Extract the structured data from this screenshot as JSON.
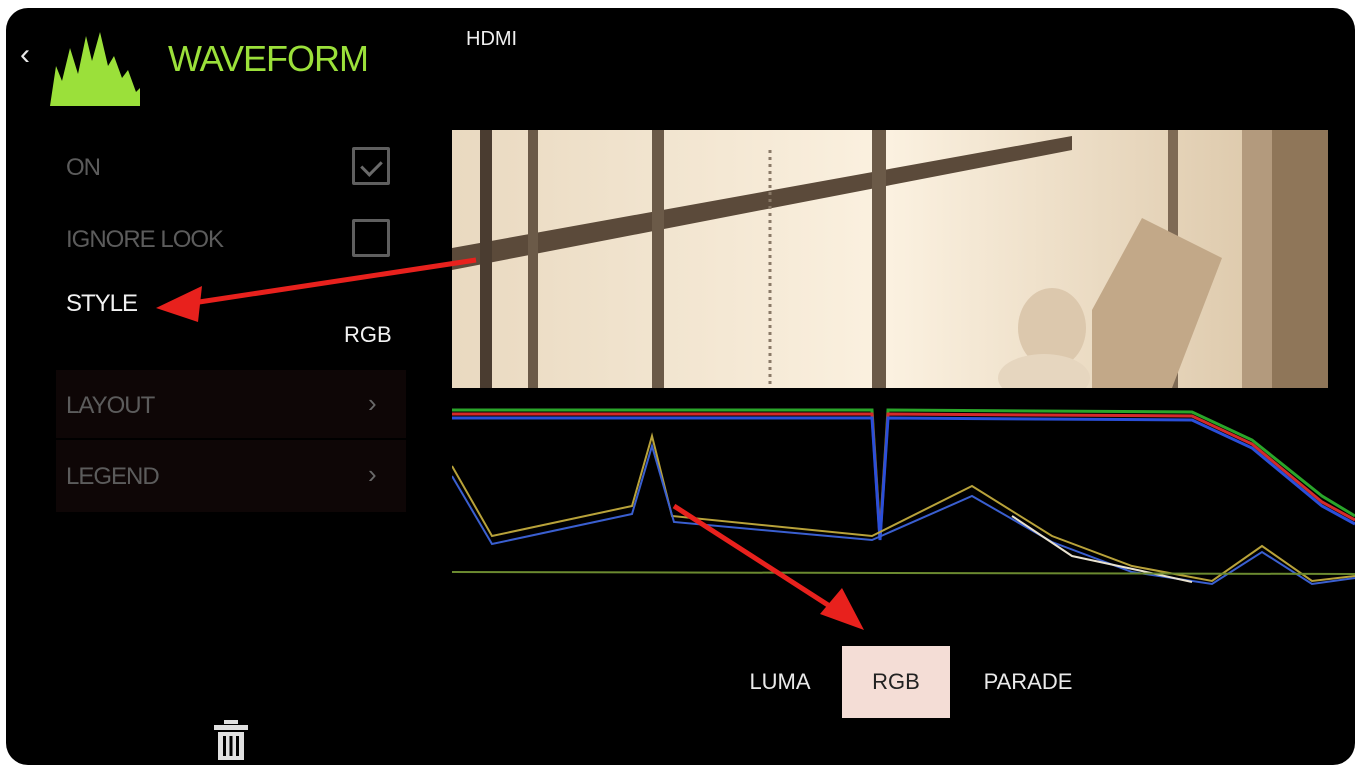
{
  "header": {
    "back_icon": "chevron-left-icon",
    "title": "WAVEFORM",
    "source": "HDMI",
    "accent_color": "#9be03a"
  },
  "settings": {
    "on": {
      "label": "ON",
      "checked": true
    },
    "ignore_look": {
      "label": "IGNORE LOOK",
      "checked": false
    },
    "style": {
      "label": "STYLE",
      "value": "RGB"
    },
    "layout": {
      "label": "LAYOUT"
    },
    "legend": {
      "label": "LEGEND"
    }
  },
  "style_options": [
    {
      "label": "LUMA",
      "selected": false
    },
    {
      "label": "RGB",
      "selected": true
    },
    {
      "label": "PARADE",
      "selected": false
    }
  ],
  "annotations": {
    "arrow_color": "#e8211d"
  },
  "footer": {
    "delete_icon": "trash-icon"
  }
}
